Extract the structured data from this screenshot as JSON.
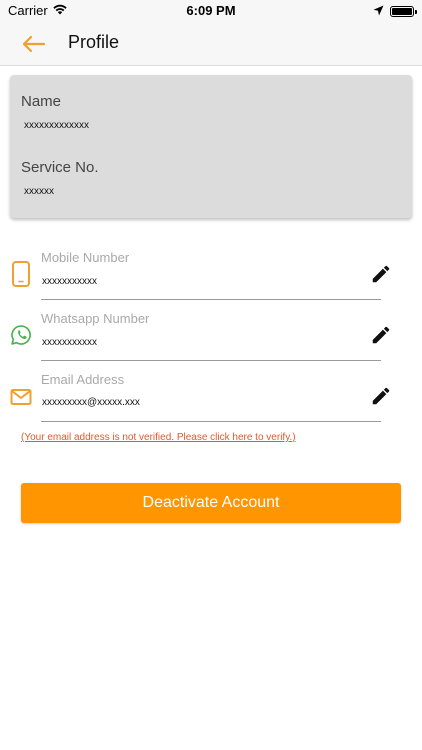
{
  "status_bar": {
    "carrier": "Carrier",
    "time": "6:09 PM"
  },
  "nav": {
    "title": "Profile"
  },
  "info_card": {
    "name_label": "Name",
    "name_value": "xxxxxxxxxxxxx",
    "service_label": "Service No.",
    "service_value": "xxxxxx"
  },
  "contacts": {
    "mobile": {
      "label": "Mobile Number",
      "value": "xxxxxxxxxxx"
    },
    "whatsapp": {
      "label": "Whatsapp Number",
      "value": "xxxxxxxxxxx"
    },
    "email": {
      "label": "Email Address",
      "value": "xxxxxxxxx@xxxxx.xxx"
    }
  },
  "verify_message": "(Your email address is not verified. Please click here to verify.)",
  "deactivate_label": "Deactivate Account",
  "colors": {
    "accent": "#ff9500",
    "back_arrow": "#f0a030",
    "whatsapp": "#4caf50",
    "warning_text": "#e05a2b"
  }
}
